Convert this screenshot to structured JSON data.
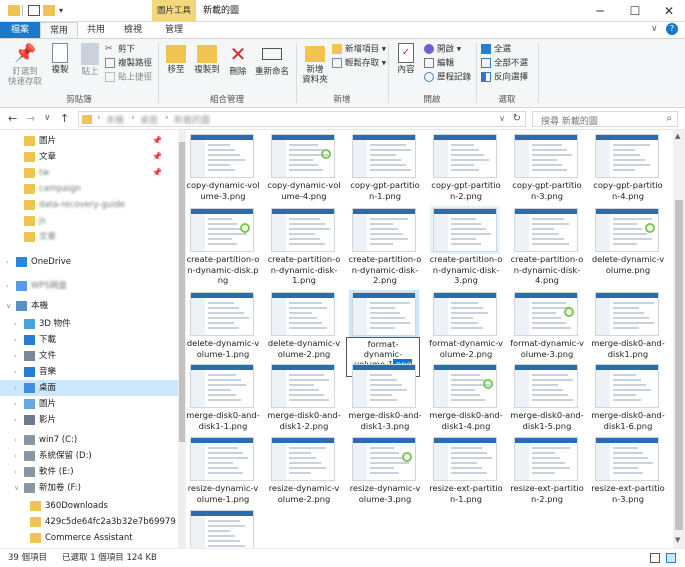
{
  "window": {
    "context_tab": "圖片工具",
    "title": "新載的圖",
    "minimize": "─",
    "maximize": "☐",
    "close": "✕"
  },
  "tabs": [
    "檔案",
    "常用",
    "共用",
    "檢視",
    "管理"
  ],
  "ribbon": {
    "clipboard": {
      "pin": "釘選到\n快速存取",
      "copy": "複製",
      "paste": "貼上",
      "cut": "剪下",
      "copy_path": "複製路徑",
      "paste_shortcut": "貼上捷徑",
      "label": "剪貼簿"
    },
    "organize": {
      "move_to": "移至",
      "copy_to": "複製到",
      "delete": "刪除",
      "rename": "重新命名",
      "label": "組合管理"
    },
    "new": {
      "new_folder": "新增\n資料夾",
      "new_item": "新增項目 ▾",
      "easy_access": "輕鬆存取 ▾",
      "label": "新增"
    },
    "open": {
      "properties": "內容",
      "open": "開啟 ▾",
      "edit": "編輯",
      "history": "歷程記錄",
      "label": "開啟"
    },
    "select": {
      "select_all": "全選",
      "select_none": "全部不選",
      "invert": "反向選擇",
      "label": "選取"
    }
  },
  "address": {
    "back": "←",
    "forward": "→",
    "recent": "∨",
    "up": "↑",
    "path": [
      "本機",
      "桌面",
      "新載的圖"
    ],
    "refresh": "↻",
    "search_placeholder": "搜尋 新載的圖"
  },
  "nav": [
    {
      "label": "圖片",
      "pinned": true,
      "color": "#f0c44e"
    },
    {
      "label": "文章",
      "pinned": true,
      "color": "#f0c44e"
    },
    {
      "label": "tw",
      "pinned": true,
      "color": "#f0c44e"
    },
    {
      "label": "campaign",
      "pinned": false,
      "color": "#f0c44e"
    },
    {
      "label": "data-recovery-guide",
      "pinned": false,
      "color": "#f0c44e"
    },
    {
      "label": "js",
      "pinned": false,
      "color": "#f0c44e"
    },
    {
      "label": "文章",
      "pinned": false,
      "color": "#f0c44e"
    },
    {
      "label": "OneDrive",
      "pinned": false,
      "color": "#2b88d8"
    },
    {
      "label": "WPS网盘",
      "pinned": false,
      "color": "#5a9be8"
    },
    {
      "label": "本機",
      "pinned": false,
      "color": "#5b8fc7"
    },
    {
      "label": "3D 物件",
      "pinned": false,
      "color": "#4aa3df"
    },
    {
      "label": "下載",
      "pinned": false,
      "color": "#2b7bd3"
    },
    {
      "label": "文件",
      "pinned": false,
      "color": "#7a8797"
    },
    {
      "label": "音樂",
      "pinned": false,
      "color": "#2b7bd3"
    },
    {
      "label": "桌面",
      "pinned": false,
      "color": "#3d8fe0"
    },
    {
      "label": "圖片",
      "pinned": false,
      "color": "#6aa9df"
    },
    {
      "label": "影片",
      "pinned": false,
      "color": "#6e7b8c"
    },
    {
      "label": "win7 (C:)",
      "pinned": false,
      "color": "#8a96a3"
    },
    {
      "label": "系統保留 (D:)",
      "pinned": false,
      "color": "#8a96a3"
    },
    {
      "label": "軟件 (E:)",
      "pinned": false,
      "color": "#8a96a3"
    },
    {
      "label": "新加卷 (F:)",
      "pinned": false,
      "color": "#8a96a3"
    },
    {
      "label": "360Downloads",
      "pinned": false,
      "color": "#f0c44e"
    },
    {
      "label": "429c5de64fc2a3b32e7b69979",
      "pinned": false,
      "color": "#f0c44e"
    },
    {
      "label": "Commerce Assistant",
      "pinned": false,
      "color": "#f0c44e"
    }
  ],
  "files": [
    "copy-dynamic-volume-3.png",
    "copy-dynamic-volume-4.png",
    "copy-gpt-partition-1.png",
    "copy-gpt-partition-2.png",
    "copy-gpt-partition-3.png",
    "copy-gpt-partition-4.png",
    "create-partition-on-dynamic-disk.png",
    "create-partition-on-dynamic-disk-1.png",
    "create-partition-on-dynamic-disk-2.png",
    "create-partition-on-dynamic-disk-3.png",
    "create-partition-on-dynamic-disk-4.png",
    "delete-dynamic-volume.png",
    "delete-dynamic-volume-1.png",
    "delete-dynamic-volume-2.png",
    "format-dynamic-volume-1.png",
    "format-dynamic-volume-2.png",
    "format-dynamic-volume-3.png",
    "merge-disk0-and-disk1.png",
    "merge-disk0-and-disk1-1.png",
    "merge-disk0-and-disk1-2.png",
    "merge-disk0-and-disk1-3.png",
    "merge-disk0-and-disk1-4.png",
    "merge-disk0-and-disk1-5.png",
    "merge-disk0-and-disk1-6.png",
    "resize-dynamic-volume-1.png",
    "resize-dynamic-volume-2.png",
    "resize-dynamic-volume-3.png",
    "resize-ext-partition-1.png",
    "resize-ext-partition-2.png",
    "resize-ext-partition-3.png",
    ""
  ],
  "rename": {
    "line1": "format-",
    "line2": "dynamic-",
    "line3_pre": "volume-1",
    "line3_sel": ".png"
  },
  "status": {
    "count": "39 個項目",
    "selected": "已選取 1 個項目  124 KB"
  }
}
